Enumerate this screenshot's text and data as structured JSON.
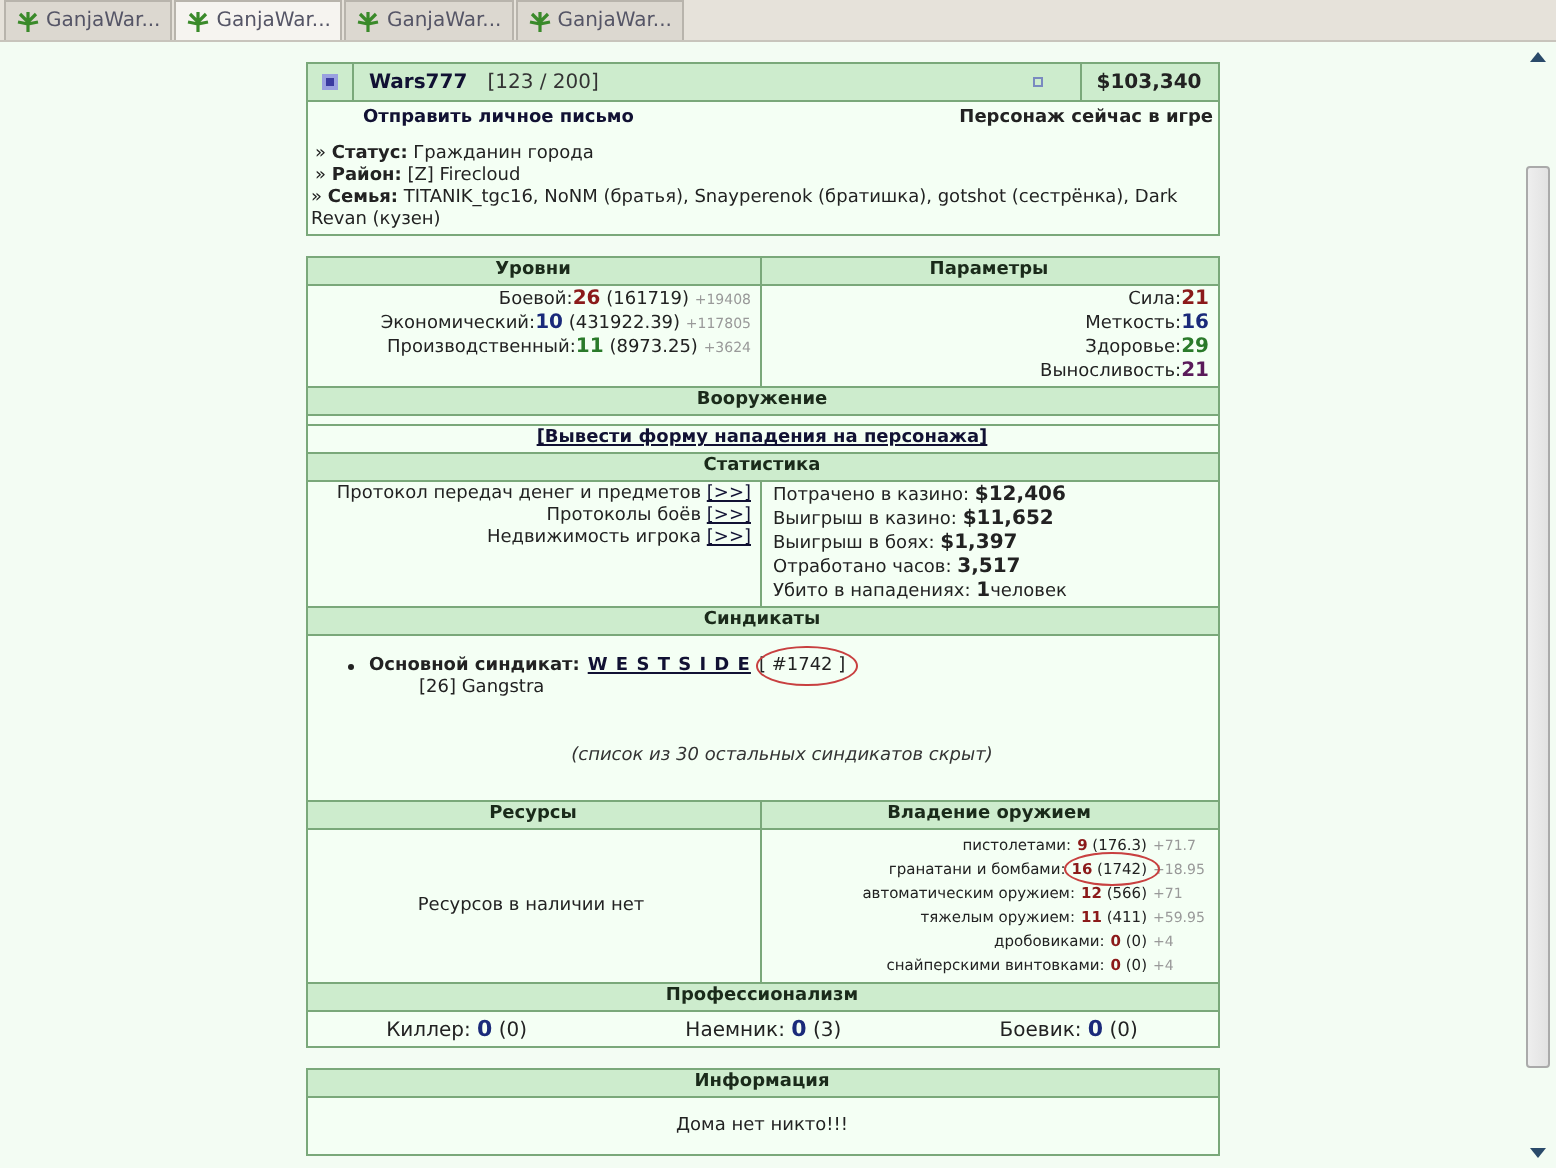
{
  "tabs": [
    {
      "label": "GanjaWar...",
      "selected": false
    },
    {
      "label": "GanjaWar...",
      "selected": true
    },
    {
      "label": "GanjaWar...",
      "selected": false
    },
    {
      "label": "GanjaWar...",
      "selected": false
    }
  ],
  "profile": {
    "name": "Wars777",
    "level": "[123 / 200]",
    "money": "$103,340",
    "send_message": "Отправить личное письмо",
    "online": "Персонаж сейчас в игре",
    "bullet": "»",
    "info": [
      {
        "label": "Статус:",
        "value": "Гражданин города"
      },
      {
        "label": "Район:",
        "value": "[Z] Firecloud"
      },
      {
        "label": "Семья:",
        "value": "TITANIK_tgc16, NoNM (братья), Snayperenok (братишка), gotshot (сестрёнка), Dark Revan (кузен)"
      }
    ]
  },
  "levels": {
    "heading": "Уровни",
    "rows": [
      {
        "label": "Боевой:",
        "value": "26",
        "color": "#8b1a1a",
        "exp": "(161719)",
        "delta": "+19408"
      },
      {
        "label": "Экономический:",
        "value": "10",
        "color": "#1a2a7a",
        "exp": "(431922.39)",
        "delta": "+117805"
      },
      {
        "label": "Производственный:",
        "value": "11",
        "color": "#2a7a2a",
        "exp": "(8973.25)",
        "delta": "+3624"
      }
    ]
  },
  "parameters": {
    "heading": "Параметры",
    "rows": [
      {
        "label": "Сила:",
        "value": "21",
        "color": "#8b1a1a"
      },
      {
        "label": "Меткость:",
        "value": "16",
        "color": "#1a2a7a"
      },
      {
        "label": "Здоровье:",
        "value": "29",
        "color": "#2a7a2a"
      },
      {
        "label": "Выносливость:",
        "value": "21",
        "color": "#5a1a5a"
      }
    ]
  },
  "armament": {
    "heading": "Вооружение",
    "attack_link": "[Вывести форму нападения на персонажа]"
  },
  "statistics": {
    "heading": "Статистика",
    "links": [
      {
        "label": "Протокол передач денег и предметов",
        "link": "[>>]"
      },
      {
        "label": "Протоколы боёв",
        "link": "[>>]"
      },
      {
        "label": "Недвижимость игрока",
        "link": "[>>]"
      }
    ],
    "rows": [
      {
        "label": "Потрачено в казино:",
        "value": "$12,406"
      },
      {
        "label": "Выигрыш в казино:",
        "value": "$11,652"
      },
      {
        "label": "Выигрыш в боях:",
        "value": "$1,397"
      },
      {
        "label": "Отработано часов:",
        "value": "3,517"
      },
      {
        "label": "Убито в нападениях:",
        "value": "1",
        "suffix": "человек"
      }
    ]
  },
  "syndicates": {
    "heading": "Синдикаты",
    "label": "Основной синдикат:",
    "name": "W E S T S I D E",
    "number": "[ #1742 ]",
    "circled": true,
    "member": "[26] Gangstra",
    "note": "(список из 30 остальных синдикатов скрыт)"
  },
  "resources": {
    "heading": "Ресурсы",
    "text": "Ресурсов в наличии нет"
  },
  "weapons": {
    "heading": "Владение оружием",
    "rows": [
      {
        "label": "пистолетами:",
        "value": "9",
        "exp": "(176.3)",
        "delta": "+71.7",
        "circled": false
      },
      {
        "label": "гранатани и бомбами:",
        "value": "16",
        "exp": "(1742)",
        "delta": "+18.95",
        "circled": true
      },
      {
        "label": "автоматическим оружием:",
        "value": "12",
        "exp": "(566)",
        "delta": "+71",
        "circled": false
      },
      {
        "label": "тяжелым оружием:",
        "value": "11",
        "exp": "(411)",
        "delta": "+59.95",
        "circled": false
      },
      {
        "label": "дробовиками:",
        "value": "0",
        "exp": "(0)",
        "delta": "+4",
        "circled": false
      },
      {
        "label": "снайперскими винтовками:",
        "value": "0",
        "exp": "(0)",
        "delta": "+4",
        "circled": false
      }
    ]
  },
  "professionalism": {
    "heading": "Профессионализм",
    "items": [
      {
        "label": "Киллер:",
        "value": "0",
        "extra": "(0)"
      },
      {
        "label": "Наемник:",
        "value": "0",
        "extra": "(3)"
      },
      {
        "label": "Боевик:",
        "value": "0",
        "extra": "(0)"
      }
    ]
  },
  "information": {
    "heading": "Информация",
    "text": "Дома нет никто!!!"
  }
}
